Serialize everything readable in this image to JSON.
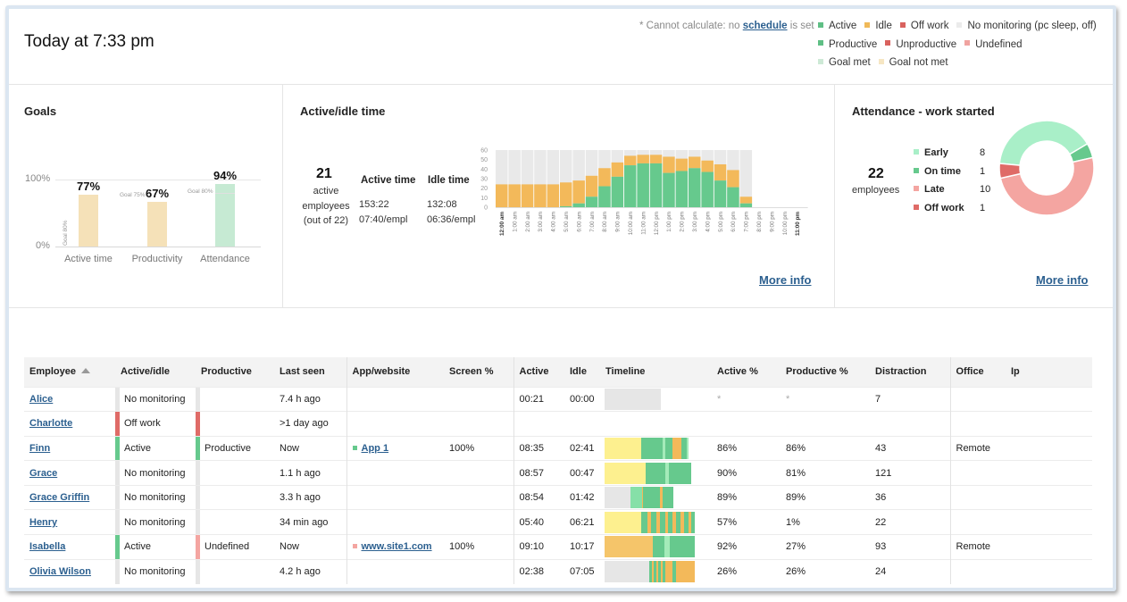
{
  "header": {
    "title": "Today at 7:33 pm",
    "note_prefix": "* Cannot calculate: no ",
    "note_link": "schedule",
    "note_suffix": " is set"
  },
  "legend": {
    "rows": [
      [
        {
          "label": "Active",
          "color": "#5fbf85"
        },
        {
          "label": "Idle",
          "color": "#f0b958"
        },
        {
          "label": "Off work",
          "color": "#d9625e"
        },
        {
          "label": "No monitoring (pc sleep, off)",
          "color": "#ebebeb"
        }
      ],
      [
        {
          "label": "Productive",
          "color": "#5fbf85"
        },
        {
          "label": "Unproductive",
          "color": "#d9625e"
        },
        {
          "label": "Undefined",
          "color": "#f0a3a0"
        }
      ],
      [
        {
          "label": "Goal met",
          "color": "#cde9d6"
        },
        {
          "label": "Goal not met",
          "color": "#f6e6c3"
        }
      ]
    ]
  },
  "colors": {
    "active": "#66c98d",
    "idle": "#f3b95a",
    "off_work": "#df6b67",
    "no_monitoring": "#e9e9e9",
    "undefined": "#f4a5a1",
    "goal_met": "#c6ead3",
    "goal_not_met": "#f5e1b8",
    "link": "#2b5f8f",
    "yellow_idle": "#fdf08f",
    "light_green": "#a4ebb9"
  },
  "goals": {
    "title": "Goals",
    "axis": {
      "top": "100%",
      "bottom": "0%"
    },
    "items": [
      {
        "category": "Active time",
        "value_label": "77%",
        "value": 77,
        "goal_label": "Goal 80%",
        "goal": 80,
        "met": false
      },
      {
        "category": "Productivity",
        "value_label": "67%",
        "value": 67,
        "goal_label": "Goal 75%",
        "goal": 75,
        "met": false
      },
      {
        "category": "Attendance",
        "value_label": "94%",
        "value": 94,
        "goal_label": "Goal 80%",
        "goal": 80,
        "met": true
      }
    ]
  },
  "active_idle": {
    "title": "Active/idle time",
    "employees_count": "21",
    "employees_line1": "active",
    "employees_line2": "employees",
    "employees_line3": "(out of 22)",
    "active_header": "Active time",
    "idle_header": "Idle time",
    "active_total": "153:22",
    "active_per": "07:40/empl",
    "idle_total": "132:08",
    "idle_per": "06:36/empl",
    "more_info": "More info"
  },
  "chart_data": {
    "type": "bar",
    "stacked": true,
    "title": "Active/idle time",
    "xlabel": "",
    "ylabel": "",
    "ylim": [
      0,
      60
    ],
    "yticks": [
      0,
      10,
      20,
      30,
      40,
      50,
      60
    ],
    "categories": [
      "12:00 am",
      "1:00 am",
      "2:00 am",
      "3:00 am",
      "4:00 am",
      "5:00 am",
      "6:00 am",
      "7:00 am",
      "8:00 am",
      "9:00 am",
      "10:00 am",
      "11:00 am",
      "12:00 pm",
      "1:00 pm",
      "2:00 pm",
      "3:00 pm",
      "4:00 pm",
      "5:00 pm",
      "6:00 pm",
      "7:00 pm",
      "8:00 pm",
      "9:00 pm",
      "10:00 pm",
      "11:00 pm"
    ],
    "bold_categories": [
      "12:00 am",
      "11:00 pm"
    ],
    "series": [
      {
        "name": "Active",
        "values": [
          0,
          0,
          0,
          0,
          0,
          1,
          4,
          11,
          22,
          32,
          44,
          46,
          46,
          36,
          38,
          41,
          37,
          28,
          21,
          4,
          0,
          0,
          0,
          0
        ]
      },
      {
        "name": "Idle",
        "values": [
          24,
          24,
          24,
          24,
          24,
          25,
          24,
          22,
          19,
          15,
          10,
          9,
          9,
          17,
          13,
          12,
          12,
          17,
          18,
          7,
          0,
          0,
          0,
          0
        ]
      }
    ],
    "background_until_index": 19,
    "grid": false,
    "legend": "none"
  },
  "attendance": {
    "title": "Attendance - work started",
    "employees_count": "22",
    "employees_label": "employees",
    "items": [
      {
        "label": "Early",
        "count": 8,
        "color": "#a9efc8"
      },
      {
        "label": "On time",
        "count": 1,
        "color": "#66c98d"
      },
      {
        "label": "Late",
        "count": 10,
        "color": "#f4a5a1"
      },
      {
        "label": "Off work",
        "count": 1,
        "color": "#df6b67"
      }
    ],
    "more_info": "More info"
  },
  "table": {
    "columns": [
      "Employee",
      "Active/idle",
      "Productive",
      "Last seen",
      "App/website",
      "Screen %",
      "Active",
      "Idle",
      "Timeline",
      "Active %",
      "Productive %",
      "Distraction",
      "Office",
      "Ip"
    ],
    "rows": [
      {
        "employee": "Alice",
        "status": "No monitoring",
        "status_color": "#e6e6e6",
        "productive": "",
        "prod_color": "#e6e6e6",
        "last_seen": "7.4 h ago",
        "app": "",
        "app_color": "",
        "screen": "",
        "active": "00:21",
        "idle": "00:00",
        "active_pct": "*",
        "productive_pct": "*",
        "distraction": "7",
        "office": "",
        "ip": "",
        "timeline": [
          [
            "#e6e6e6",
            100
          ]
        ],
        "timeline_len": 0.53
      },
      {
        "employee": "Charlotte",
        "status": "Off work",
        "status_color": "#df6b67",
        "productive": "",
        "prod_color": "#df6b67",
        "last_seen": ">1 day ago",
        "app": "",
        "app_color": "",
        "screen": "",
        "active": "",
        "idle": "",
        "active_pct": "",
        "productive_pct": "",
        "distraction": "",
        "office": "",
        "ip": "",
        "timeline": [],
        "timeline_len": 0
      },
      {
        "employee": "Finn",
        "status": "Active",
        "status_color": "#66c98d",
        "productive": "Productive",
        "prod_color": "#66c98d",
        "last_seen": "Now",
        "app": "App 1",
        "app_color": "#66c98d",
        "screen": "100%",
        "active": "08:35",
        "idle": "02:41",
        "active_pct": "86%",
        "productive_pct": "86%",
        "distraction": "43",
        "office": "Remote",
        "ip": "",
        "timeline": [
          [
            "#fdf08f",
            41
          ],
          [
            "#66c98d",
            24
          ],
          [
            "#a4ebb9",
            3
          ],
          [
            "#66c98d",
            8
          ],
          [
            "#f3b95a",
            10
          ],
          [
            "#66c98d",
            6
          ],
          [
            "#a4ebb9",
            2
          ]
        ],
        "timeline_len": 0.85
      },
      {
        "employee": "Grace",
        "status": "No monitoring",
        "status_color": "#e6e6e6",
        "productive": "",
        "prod_color": "#e6e6e6",
        "last_seen": "1.1 h ago",
        "app": "",
        "app_color": "",
        "screen": "",
        "active": "08:57",
        "idle": "00:47",
        "active_pct": "90%",
        "productive_pct": "81%",
        "distraction": "121",
        "office": "",
        "ip": "",
        "timeline": [
          [
            "#fdf08f",
            48
          ],
          [
            "#66c98d",
            22
          ],
          [
            "#a4ebb9",
            4
          ],
          [
            "#66c98d",
            26
          ]
        ],
        "timeline_len": 0.82
      },
      {
        "employee": "Grace Griffin",
        "status": "No monitoring",
        "status_color": "#e6e6e6",
        "productive": "",
        "prod_color": "#e6e6e6",
        "last_seen": "3.3 h ago",
        "app": "",
        "app_color": "",
        "screen": "",
        "active": "08:54",
        "idle": "01:42",
        "active_pct": "89%",
        "productive_pct": "89%",
        "distraction": "36",
        "office": "",
        "ip": "",
        "timeline": [
          [
            "#e6e6e6",
            34
          ],
          [
            "#86e0a8",
            15
          ],
          [
            "#f3b95a",
            2
          ],
          [
            "#66c98d",
            22
          ],
          [
            "#f3b95a",
            3
          ],
          [
            "#66c98d",
            15
          ]
        ],
        "timeline_len": 0.72
      },
      {
        "employee": "Henry",
        "status": "No monitoring",
        "status_color": "#e6e6e6",
        "productive": "",
        "prod_color": "#e6e6e6",
        "last_seen": "34 min ago",
        "app": "",
        "app_color": "",
        "screen": "",
        "active": "05:40",
        "idle": "06:21",
        "active_pct": "57%",
        "productive_pct": "1%",
        "distraction": "22",
        "office": "",
        "ip": "",
        "timeline": [
          [
            "#fdf08f",
            40
          ],
          [
            "#66c98d",
            7
          ],
          [
            "#f3b95a",
            4
          ],
          [
            "#66c98d",
            6
          ],
          [
            "#f3b95a",
            4
          ],
          [
            "#66c98d",
            6
          ],
          [
            "#f3b95a",
            3
          ],
          [
            "#66c98d",
            5
          ],
          [
            "#f3b95a",
            4
          ],
          [
            "#66c98d",
            5
          ],
          [
            "#f3b95a",
            4
          ],
          [
            "#66c98d",
            5
          ],
          [
            "#f3b95a",
            3
          ],
          [
            "#66c98d",
            4
          ]
        ],
        "timeline_len": 0.86
      },
      {
        "employee": "Isabella",
        "status": "Active",
        "status_color": "#66c98d",
        "productive": "Undefined",
        "prod_color": "#f4a5a1",
        "last_seen": "Now",
        "app": "www.site1.com",
        "app_color": "#f4a5a1",
        "screen": "100%",
        "active": "09:10",
        "idle": "10:17",
        "active_pct": "92%",
        "productive_pct": "27%",
        "distraction": "93",
        "office": "Remote",
        "ip": "",
        "timeline": [
          [
            "#f5c56a",
            53
          ],
          [
            "#66c98d",
            13
          ],
          [
            "#a4ebb9",
            6
          ],
          [
            "#66c98d",
            28
          ]
        ],
        "timeline_len": 0.86
      },
      {
        "employee": "Olivia Wilson",
        "status": "No monitoring",
        "status_color": "#e6e6e6",
        "productive": "",
        "prod_color": "#e6e6e6",
        "last_seen": "4.2 h ago",
        "app": "",
        "app_color": "",
        "screen": "",
        "active": "02:38",
        "idle": "07:05",
        "active_pct": "26%",
        "productive_pct": "26%",
        "distraction": "24",
        "office": "",
        "ip": "",
        "timeline": [
          [
            "#e6e6e6",
            49
          ],
          [
            "#66c98d",
            3
          ],
          [
            "#f3b95a",
            2
          ],
          [
            "#66c98d",
            3
          ],
          [
            "#f3b95a",
            2
          ],
          [
            "#66c98d",
            3
          ],
          [
            "#f3b95a",
            2
          ],
          [
            "#66c98d",
            3
          ],
          [
            "#f3b95a",
            8
          ],
          [
            "#66c98d",
            4
          ],
          [
            "#f3b95a",
            21
          ]
        ],
        "timeline_len": 0.86
      }
    ]
  }
}
